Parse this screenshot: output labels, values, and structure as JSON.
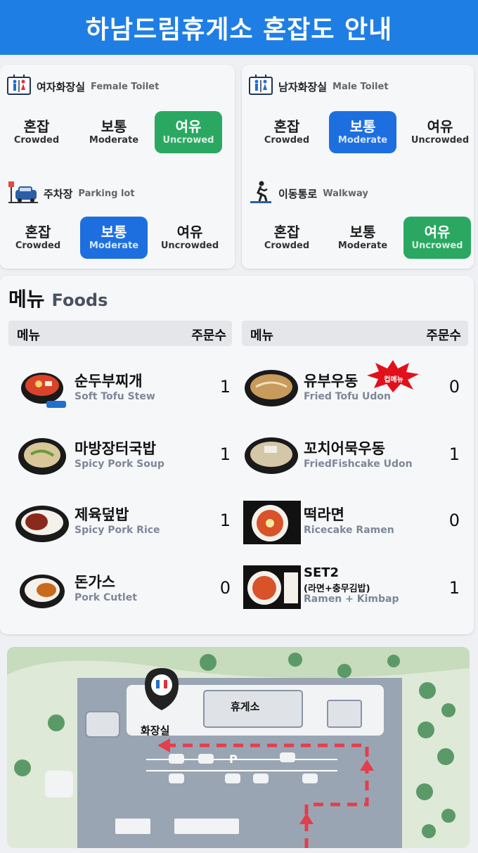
{
  "header": {
    "title": "하남드림휴게소 혼잡도 안내"
  },
  "levels": {
    "crowded_kr": "혼잡",
    "crowded_en": "Crowded",
    "moderate_kr": "보통",
    "moderate_en": "Moderate",
    "uncrowded_kr": "여유",
    "uncrowded_en": "Uncrowed",
    "uncrowded_en_alt": "Uncrowded"
  },
  "sections": [
    {
      "name_kr": "여자화장실",
      "name_en": "Female Toilet",
      "active": "uncrowded",
      "icon": "restroom-icon"
    },
    {
      "name_kr": "남자화장실",
      "name_en": "Male Toilet",
      "active": "moderate",
      "icon": "restroom-icon"
    },
    {
      "name_kr": "주차장",
      "name_en": "Parking lot",
      "active": "moderate",
      "icon": "parking-car-icon"
    },
    {
      "name_kr": "이동통로",
      "name_en": "Walkway",
      "active": "uncrowded",
      "icon": "walking-person-icon"
    }
  ],
  "menu": {
    "title_kr": "메뉴",
    "title_en": "Foods",
    "col_menu": "메뉴",
    "col_orders": "주문수",
    "left": [
      {
        "kr": "순두부찌개",
        "en": "Soft Tofu Stew",
        "count": "1"
      },
      {
        "kr": "마방장터국밥",
        "en": "Spicy Pork Soup",
        "count": "1"
      },
      {
        "kr": "제육덮밥",
        "en": "Spicy Pork Rice",
        "count": "1"
      },
      {
        "kr": "돈가스",
        "en": "Pork Cutlet",
        "count": "0"
      }
    ],
    "right": [
      {
        "kr": "유부우동",
        "en": "Fried Tofu Udon",
        "count": "0",
        "badge": "컵메뉴"
      },
      {
        "kr": "꼬치어묵우동",
        "en": "FriedFishcake Udon",
        "count": "1"
      },
      {
        "kr": "떡라면",
        "en": "Ricecake Ramen",
        "count": "0"
      },
      {
        "kr": "SET2",
        "kr2": "(라면+충무김밥)",
        "en": "Ramen + Kimbap",
        "count": "1"
      }
    ]
  },
  "map": {
    "restroom_label": "화장실",
    "rest_area_label": "휴게소",
    "parking_label": "P"
  },
  "colors": {
    "header_blue": "#1f7ee4",
    "active_green": "#2aa862",
    "active_blue": "#1d6fe0"
  }
}
